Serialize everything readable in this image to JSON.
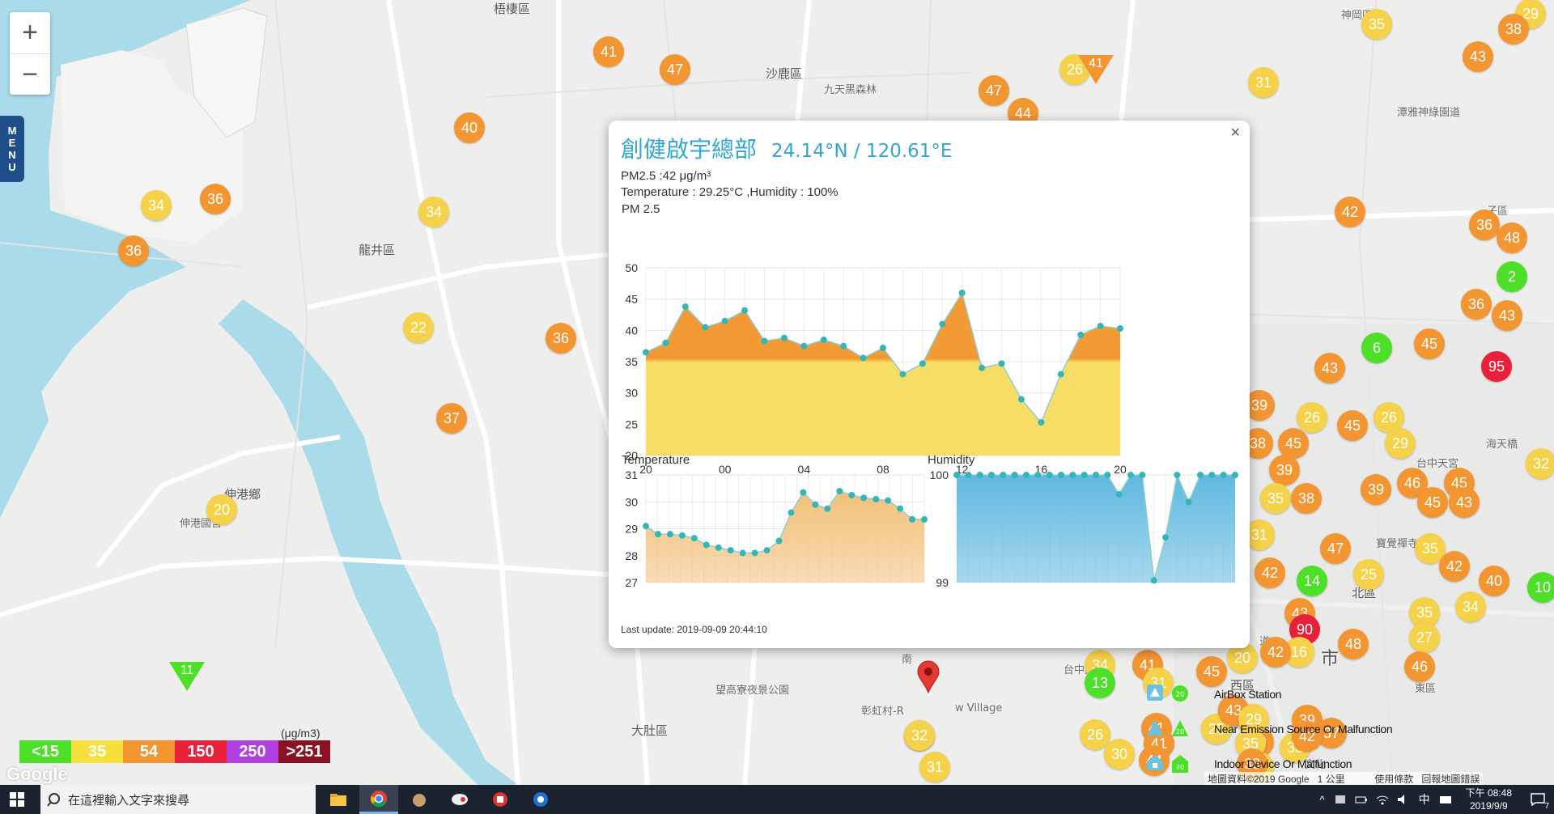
{
  "map": {
    "place_labels": [
      {
        "text": "梧棲區"
      },
      {
        "text": "沙鹿區"
      },
      {
        "text": "九天黑森林"
      },
      {
        "text": "龍井區"
      },
      {
        "text": "伸港鄉"
      },
      {
        "text": "伸港國宮"
      },
      {
        "text": "大肚區"
      },
      {
        "text": "望高寮夜景公園"
      },
      {
        "text": "彰虹村-R"
      },
      {
        "text": "w Village"
      },
      {
        "text": "南"
      },
      {
        "text": "西區"
      },
      {
        "text": "台中嘉德"
      },
      {
        "text": "北區"
      },
      {
        "text": "市"
      },
      {
        "text": "神岡區"
      },
      {
        "text": "潭雅神綠園道"
      },
      {
        "text": "子區"
      },
      {
        "text": "海天橋"
      },
      {
        "text": "台中天宮"
      },
      {
        "text": "寶覺禪寺"
      },
      {
        "text": "文化"
      },
      {
        "text": "道"
      },
      {
        "text": "東區"
      }
    ],
    "markers": [
      {
        "value": "41",
        "color": "#f39632"
      },
      {
        "value": "47",
        "color": "#f39632"
      },
      {
        "value": "40",
        "color": "#f39632"
      },
      {
        "value": "34",
        "color": "#f6d24a"
      },
      {
        "value": "36",
        "color": "#f39632"
      },
      {
        "value": "36",
        "color": "#f39632"
      },
      {
        "value": "34",
        "color": "#f6d24a"
      },
      {
        "value": "22",
        "color": "#f6d24a"
      },
      {
        "value": "36",
        "color": "#f39632"
      },
      {
        "value": "37",
        "color": "#f39632"
      },
      {
        "value": "20",
        "color": "#f6d24a"
      },
      {
        "value": "47",
        "color": "#f39632"
      },
      {
        "value": "44",
        "color": "#f39632"
      },
      {
        "value": "26",
        "color": "#f6d24a"
      },
      {
        "value": "31",
        "color": "#f6d24a"
      },
      {
        "value": "35",
        "color": "#f6d24a"
      },
      {
        "value": "29",
        "color": "#f6d24a"
      },
      {
        "value": "38",
        "color": "#f39632"
      },
      {
        "value": "43",
        "color": "#f39632"
      },
      {
        "value": "42",
        "color": "#f39632"
      },
      {
        "value": "36",
        "color": "#f39632"
      },
      {
        "value": "48",
        "color": "#f39632"
      },
      {
        "value": "2",
        "color": "#4de028"
      },
      {
        "value": "36",
        "color": "#f39632"
      },
      {
        "value": "43",
        "color": "#f39632"
      },
      {
        "value": "6",
        "color": "#4de028"
      },
      {
        "value": "45",
        "color": "#f39632"
      },
      {
        "value": "43",
        "color": "#f39632"
      },
      {
        "value": "95",
        "color": "#e8203a"
      },
      {
        "value": "39",
        "color": "#f39632"
      },
      {
        "value": "26",
        "color": "#f6d24a"
      },
      {
        "value": "26",
        "color": "#f6d24a"
      },
      {
        "value": "45",
        "color": "#f39632"
      },
      {
        "value": "38",
        "color": "#f39632"
      },
      {
        "value": "45",
        "color": "#f39632"
      },
      {
        "value": "29",
        "color": "#f6d24a"
      },
      {
        "value": "32",
        "color": "#f6d24a"
      },
      {
        "value": "39",
        "color": "#f39632"
      },
      {
        "value": "35",
        "color": "#f6d24a"
      },
      {
        "value": "38",
        "color": "#f39632"
      },
      {
        "value": "39",
        "color": "#f39632"
      },
      {
        "value": "46",
        "color": "#f39632"
      },
      {
        "value": "45",
        "color": "#f39632"
      },
      {
        "value": "45",
        "color": "#f39632"
      },
      {
        "value": "43",
        "color": "#f39632"
      },
      {
        "value": "31",
        "color": "#f6d24a"
      },
      {
        "value": "47",
        "color": "#f39632"
      },
      {
        "value": "42",
        "color": "#f39632"
      },
      {
        "value": "14",
        "color": "#4de028"
      },
      {
        "value": "25",
        "color": "#f6d24a"
      },
      {
        "value": "35",
        "color": "#f6d24a"
      },
      {
        "value": "42",
        "color": "#f39632"
      },
      {
        "value": "40",
        "color": "#f39632"
      },
      {
        "value": "10",
        "color": "#4de028"
      },
      {
        "value": "34",
        "color": "#f6d24a"
      },
      {
        "value": "35",
        "color": "#f6d24a"
      },
      {
        "value": "43",
        "color": "#f39632"
      },
      {
        "value": "90",
        "color": "#e8203a"
      },
      {
        "value": "48",
        "color": "#f39632"
      },
      {
        "value": "27",
        "color": "#f6d24a"
      },
      {
        "value": "16",
        "color": "#f6d24a"
      },
      {
        "value": "42",
        "color": "#f39632"
      },
      {
        "value": "46",
        "color": "#f39632"
      },
      {
        "value": "20",
        "color": "#f6d24a"
      },
      {
        "value": "34",
        "color": "#f6d24a"
      },
      {
        "value": "41",
        "color": "#f39632"
      },
      {
        "value": "13",
        "color": "#4de028"
      },
      {
        "value": "31",
        "color": "#f6d24a"
      },
      {
        "value": "45",
        "color": "#f39632"
      },
      {
        "value": "43",
        "color": "#f39632"
      },
      {
        "value": "35",
        "color": "#f6d24a"
      },
      {
        "value": "39",
        "color": "#f39632"
      },
      {
        "value": "37",
        "color": "#f39632"
      },
      {
        "value": "32",
        "color": "#f6d24a"
      },
      {
        "value": "26",
        "color": "#f6d24a"
      },
      {
        "value": "41",
        "color": "#f39632"
      },
      {
        "value": "25",
        "color": "#f6d24a"
      },
      {
        "value": "41",
        "color": "#f39632"
      },
      {
        "value": "39",
        "color": "#f39632"
      },
      {
        "value": "33",
        "color": "#f6d24a"
      },
      {
        "value": "30",
        "color": "#f6d24a"
      },
      {
        "value": "44",
        "color": "#f39632"
      },
      {
        "value": "28",
        "color": "#f6d24a"
      },
      {
        "value": "42",
        "color": "#f39632"
      },
      {
        "value": "32",
        "color": "#f6d24a"
      },
      {
        "value": "31",
        "color": "#f6d24a"
      },
      {
        "value": "43",
        "color": "#f39632"
      },
      {
        "value": "29",
        "color": "#f6d24a"
      },
      {
        "value": "35",
        "color": "#f6d24a"
      },
      {
        "value": "38",
        "color": "#f39632"
      }
    ],
    "triangle_markers": [
      {
        "value": "11",
        "color": "green"
      },
      {
        "value": "41",
        "color": "orange"
      }
    ]
  },
  "zoom": {
    "plus": "+",
    "minus": "−"
  },
  "menu_tab": {
    "label": "MENU"
  },
  "legend": {
    "unit": "(μg/m3)",
    "items": [
      {
        "label": "<15",
        "color": "#4de028"
      },
      {
        "label": "35",
        "color": "#f6e13c"
      },
      {
        "label": "54",
        "color": "#f39632"
      },
      {
        "label": "150",
        "color": "#e8203a"
      },
      {
        "label": "250",
        "color": "#b23fe0"
      },
      {
        "label": ">251",
        "color": "#8a1222"
      }
    ]
  },
  "station_legend": {
    "items": [
      {
        "label": "AirBox Station"
      },
      {
        "label": "Near Emission Source Or Malfunction"
      },
      {
        "label": "Indoor Device Or Malfunction"
      }
    ]
  },
  "google_logo": "Google",
  "attribution": {
    "data": "地圖資料©2019 Google",
    "scale": "1 公里",
    "terms": "使用條款",
    "report": "回報地圖錯誤"
  },
  "popup": {
    "close": "×",
    "title": "創健啟宇總部",
    "coords": "24.14°N / 120.61°E",
    "pm25_line": "PM2.5 :42 μg/m³",
    "env_line": "Temperature : 29.25°C ,Humidity : 100%",
    "last_update": "Last update: 2019-09-09 20:44:10"
  },
  "chart_data": [
    {
      "type": "area",
      "title": "PM 2.5",
      "xlabel": "",
      "ylabel": "",
      "ylim": [
        20,
        50
      ],
      "yticks": [
        20,
        25,
        30,
        35,
        40,
        45,
        50
      ],
      "xticks": [
        "20",
        "00",
        "04",
        "08",
        "12",
        "16",
        "20"
      ],
      "values": [
        36.5,
        38,
        43.8,
        40.5,
        41.5,
        43.2,
        38.3,
        38.8,
        37.5,
        38.5,
        37.5,
        35.6,
        37.2,
        33,
        34.7,
        41,
        46,
        34,
        34.7,
        29,
        25.3,
        33,
        39.3,
        40.7,
        40.3
      ],
      "colors": {
        "high": "#f39a35",
        "low": "#f7dc66",
        "threshold": 35.5,
        "point": "#35b5b8"
      },
      "grid": true
    },
    {
      "type": "area",
      "title": "Temperature",
      "xlabel": "",
      "ylabel": "",
      "ylim": [
        27,
        31
      ],
      "yticks": [
        27,
        28,
        29,
        30,
        31
      ],
      "values": [
        29.1,
        28.8,
        28.8,
        28.75,
        28.65,
        28.4,
        28.3,
        28.2,
        28.1,
        28.1,
        28.2,
        28.55,
        29.6,
        30.35,
        29.9,
        29.75,
        30.4,
        30.25,
        30.15,
        30.1,
        30.05,
        29.75,
        29.35,
        29.35
      ],
      "colors": {
        "fill": "#f2c078",
        "point": "#35b5b8"
      },
      "grid": true
    },
    {
      "type": "area",
      "title": "Humidity",
      "xlabel": "",
      "ylabel": "",
      "ylim": [
        99,
        100
      ],
      "yticks": [
        99,
        100
      ],
      "values": [
        100,
        100,
        100,
        100,
        100,
        100,
        100,
        100,
        100,
        100,
        100,
        100,
        100,
        100,
        99.82,
        100,
        100,
        99.02,
        99.42,
        100,
        99.75,
        100,
        100,
        100,
        100
      ],
      "colors": {
        "fill": "#5fb9e0",
        "point": "#35b5b8"
      },
      "grid": true
    }
  ],
  "taskbar": {
    "search_placeholder": "在這裡輸入文字來搜尋",
    "time": "下午 08:48",
    "date": "2019/9/9",
    "ime": "中",
    "notification_count": "7"
  }
}
